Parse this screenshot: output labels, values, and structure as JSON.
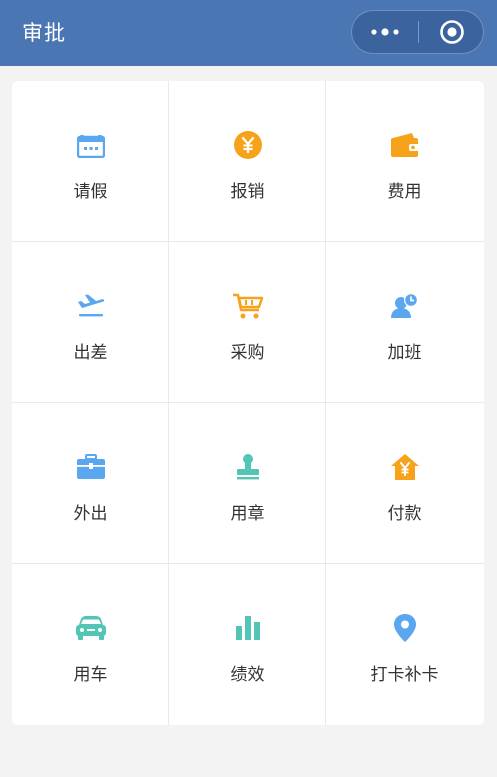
{
  "header": {
    "title": "审批",
    "background": "#4a77b4"
  },
  "capsule": {
    "more_icon": "more-dots-icon",
    "close_icon": "target-icon"
  },
  "colors": {
    "blue": "#5aa7f0",
    "orange": "#f7a21b",
    "teal": "#52c5b5"
  },
  "grid": {
    "items": [
      {
        "label": "请假",
        "icon": "calendar-icon"
      },
      {
        "label": "报销",
        "icon": "yen-coin-icon"
      },
      {
        "label": "费用",
        "icon": "wallet-icon"
      },
      {
        "label": "出差",
        "icon": "airplane-icon"
      },
      {
        "label": "采购",
        "icon": "cart-icon"
      },
      {
        "label": "加班",
        "icon": "user-clock-icon"
      },
      {
        "label": "外出",
        "icon": "briefcase-icon"
      },
      {
        "label": "用章",
        "icon": "stamp-icon"
      },
      {
        "label": "付款",
        "icon": "yen-house-icon"
      },
      {
        "label": "用车",
        "icon": "car-icon"
      },
      {
        "label": "绩效",
        "icon": "bar-chart-icon"
      },
      {
        "label": "打卡补卡",
        "icon": "location-pin-icon"
      }
    ]
  }
}
